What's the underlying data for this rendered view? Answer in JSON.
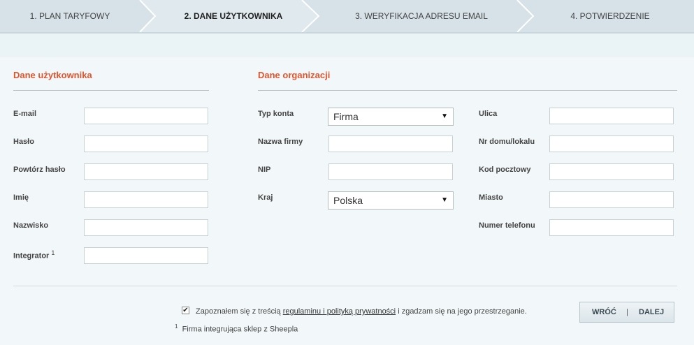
{
  "steps": [
    {
      "label": "1. PLAN TARYFOWY",
      "active": false
    },
    {
      "label": "2. DANE UŻYTKOWNIKA",
      "active": true
    },
    {
      "label": "3. WERYFIKACJA ADRESU EMAIL",
      "active": false
    },
    {
      "label": "4. POTWIERDZENIE",
      "active": false
    }
  ],
  "user_section": {
    "title": "Dane użytkownika",
    "fields": [
      {
        "label": "E-mail",
        "value": ""
      },
      {
        "label": "Hasło",
        "value": ""
      },
      {
        "label": "Powtórz hasło",
        "value": ""
      },
      {
        "label": "Imię",
        "value": ""
      },
      {
        "label": "Nazwisko",
        "value": ""
      },
      {
        "label": "Integrator",
        "footnote_marker": "1",
        "value": ""
      }
    ]
  },
  "org_section": {
    "title": "Dane organizacji",
    "left_fields": [
      {
        "label": "Typ konta",
        "type": "select",
        "value": "Firma"
      },
      {
        "label": "Nazwa firmy",
        "type": "text",
        "value": ""
      },
      {
        "label": "NIP",
        "type": "text",
        "value": ""
      },
      {
        "label": "Kraj",
        "type": "select",
        "value": "Polska"
      }
    ],
    "right_fields": [
      {
        "label": "Ulica",
        "value": ""
      },
      {
        "label": "Nr domu/lokalu",
        "value": ""
      },
      {
        "label": "Kod pocztowy",
        "value": ""
      },
      {
        "label": "Miasto",
        "value": ""
      },
      {
        "label": "Numer telefonu",
        "value": ""
      }
    ]
  },
  "consent": {
    "checked": true,
    "check_glyph": "✔",
    "text_before": "Zapoznałem się z treścią ",
    "link_text": "regulaminu i polityką prywatności",
    "text_after": " i zgadzam się na jego przestrzeganie."
  },
  "footnote": {
    "marker": "1",
    "text": "Firma integrująca sklep z Sheepla"
  },
  "buttons": {
    "back": "WRÓĆ",
    "separator": "|",
    "next": "DALEJ"
  },
  "colors": {
    "accent": "#e0552d",
    "steps_bg": "#d6e2e8",
    "active_step_bg": "#dfe9ee",
    "page_bg": "#f2f7f9"
  }
}
